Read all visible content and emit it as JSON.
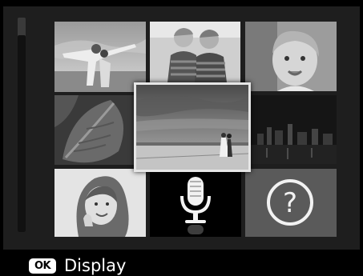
{
  "footer": {
    "ok_button_label": "OK",
    "action_label": "Display"
  },
  "thumbnails": [
    {
      "name": "photo-thumbnail-1",
      "type": "photo"
    },
    {
      "name": "photo-thumbnail-2",
      "type": "photo"
    },
    {
      "name": "photo-thumbnail-3",
      "type": "photo"
    },
    {
      "name": "photo-thumbnail-4",
      "type": "photo"
    },
    {
      "name": "photo-thumbnail-5",
      "type": "photo",
      "selected": true
    },
    {
      "name": "photo-thumbnail-6",
      "type": "photo"
    },
    {
      "name": "photo-thumbnail-7",
      "type": "photo"
    },
    {
      "name": "voice-memo-thumbnail",
      "type": "audio",
      "icon": "microphone-icon"
    },
    {
      "name": "unknown-file-thumbnail",
      "type": "unsupported",
      "icon": "question-mark-icon"
    }
  ],
  "colors": {
    "background": "#000000",
    "panel": "#1e1e1e",
    "selection_border": "#e6e6e6",
    "unknown_tile": "#5a5a5a"
  }
}
